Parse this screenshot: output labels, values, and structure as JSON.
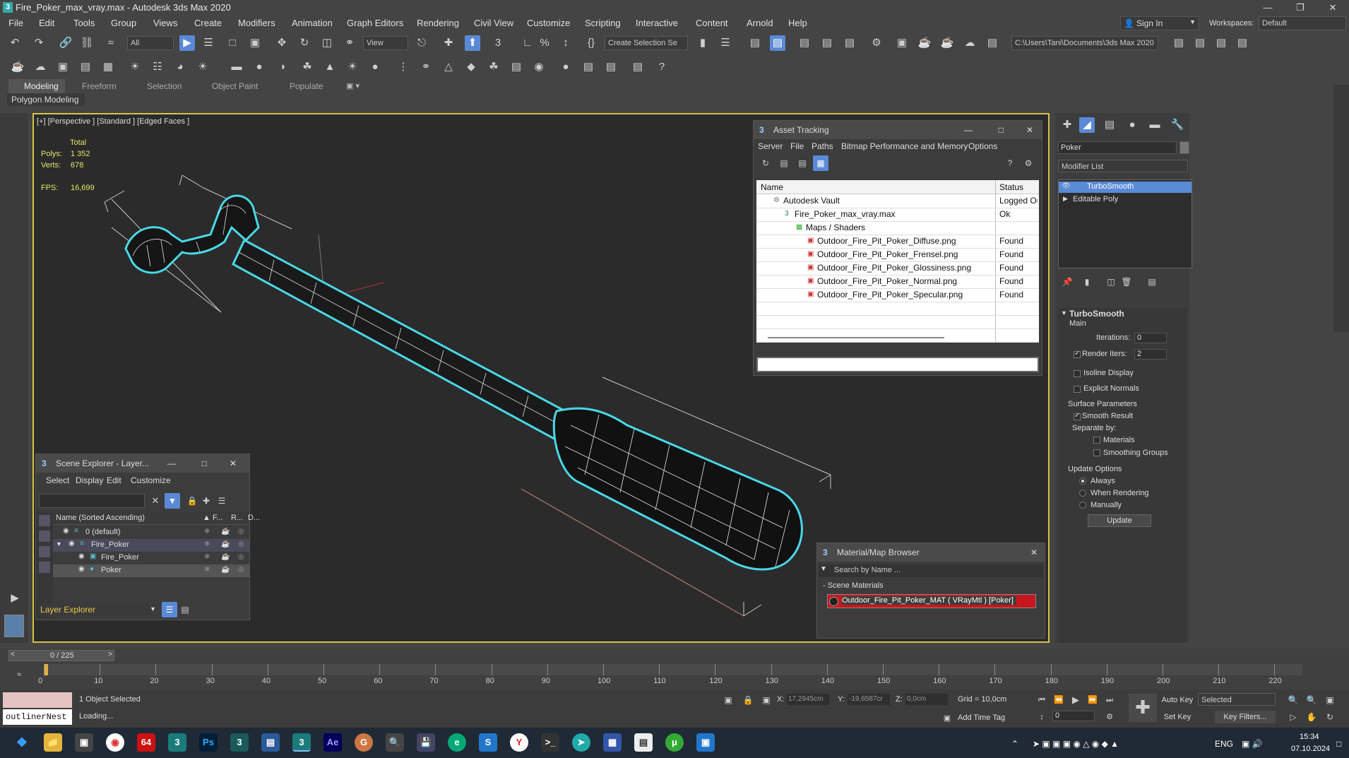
{
  "window": {
    "title": "Fire_Poker_max_vray.max - Autodesk 3ds Max 2020"
  },
  "menu": [
    "File",
    "Edit",
    "Tools",
    "Group",
    "Views",
    "Create",
    "Modifiers",
    "Animation",
    "Graph Editors",
    "Rendering",
    "Civil View",
    "Customize",
    "Scripting",
    "Interactive",
    "Content",
    "Arnold",
    "Help"
  ],
  "account": {
    "sign_in": "Sign In",
    "workspaces_label": "Workspaces:",
    "workspace": "Default"
  },
  "toolbar": {
    "filter": "All",
    "view": "View",
    "create_selection": "Create Selection Se",
    "path": "C:\\Users\\Tani\\Documents\\3ds Max 2020"
  },
  "ribbon": {
    "tabs": [
      "Modeling",
      "Freeform",
      "Selection",
      "Object Paint",
      "Populate"
    ],
    "subtab": "Polygon Modeling"
  },
  "viewport": {
    "label": "[+] [Perspective ] [Standard ] [Edged Faces ]",
    "stats_total": "Total",
    "polys_label": "Polys:",
    "polys": "1 352",
    "verts_label": "Verts:",
    "verts": "678",
    "fps_label": "FPS:",
    "fps": "16,699"
  },
  "asset_tracking": {
    "title": "Asset Tracking",
    "menu": [
      "Server",
      "File",
      "Paths",
      "Bitmap Performance and Memory",
      "Options"
    ],
    "col_name": "Name",
    "col_status": "Status",
    "rows": [
      {
        "name": "Autodesk Vault",
        "status": "Logged Ou"
      },
      {
        "name": "Fire_Poker_max_vray.max",
        "status": "Ok"
      },
      {
        "name": "Maps / Shaders",
        "status": ""
      },
      {
        "name": "Outdoor_Fire_Pit_Poker_Diffuse.png",
        "status": "Found"
      },
      {
        "name": "Outdoor_Fire_Pit_Poker_Frensel.png",
        "status": "Found"
      },
      {
        "name": "Outdoor_Fire_Pit_Poker_Glossiness.png",
        "status": "Found"
      },
      {
        "name": "Outdoor_Fire_Pit_Poker_Normal.png",
        "status": "Found"
      },
      {
        "name": "Outdoor_Fire_Pit_Poker_Specular.png",
        "status": "Found"
      }
    ]
  },
  "scene_explorer": {
    "title": "Scene Explorer - Layer...",
    "menu": [
      "Select",
      "Display",
      "Edit",
      "Customize"
    ],
    "col_name": "Name (Sorted Ascending)",
    "col_f": "▲ F...",
    "col_r": "R...",
    "col_d": "D...",
    "rows": [
      "0 (default)",
      "Fire_Poker",
      "Fire_Poker",
      "Poker"
    ],
    "footer": "Layer Explorer"
  },
  "material_browser": {
    "title": "Material/Map Browser",
    "search": "Search by Name ...",
    "section": "- Scene Materials",
    "item": "Outdoor_Fire_Pit_Poker_MAT ( VRayMtl ) [Poker]"
  },
  "command_panel": {
    "object_name": "Poker",
    "modifier_list": "Modifier List",
    "stack": [
      "TurboSmooth",
      "Editable Poly"
    ],
    "rollout": "TurboSmooth",
    "main": "Main",
    "iterations_label": "Iterations:",
    "iterations": "0",
    "render_iters_label": "Render Iters:",
    "render_iters": "2",
    "isoline": "Isoline Display",
    "explicit": "Explicit Normals",
    "surface": "Surface Parameters",
    "smooth": "Smooth Result",
    "separate": "Separate by:",
    "materials": "Materials",
    "smoothing": "Smoothing Groups",
    "update_options": "Update Options",
    "always": "Always",
    "when_rendering": "When Rendering",
    "manually": "Manually",
    "update": "Update"
  },
  "timeline": {
    "frame": "0 / 225",
    "ticks": [
      "0",
      "10",
      "20",
      "30",
      "40",
      "50",
      "60",
      "70",
      "80",
      "90",
      "100",
      "110",
      "120",
      "130",
      "140",
      "150",
      "160",
      "170",
      "180",
      "190",
      "200",
      "210",
      "220"
    ]
  },
  "status": {
    "script": "outlinerNest",
    "selected": "1 Object Selected",
    "loading": "Loading...",
    "x_label": "X:",
    "x": "17,2945cm",
    "y_label": "Y:",
    "y": "-19,6587cr",
    "z_label": "Z:",
    "z": "0,0cm",
    "grid": "Grid = 10,0cm",
    "add_time_tag": "Add Time Tag",
    "auto_key": "Auto Key",
    "set_key": "Set Key",
    "selected_mode": "Selected",
    "key_filters": "Key Filters...",
    "frame_field": "0"
  },
  "taskbar": {
    "time": "15:34",
    "date": "07.10.2024",
    "lang": "ENG"
  }
}
